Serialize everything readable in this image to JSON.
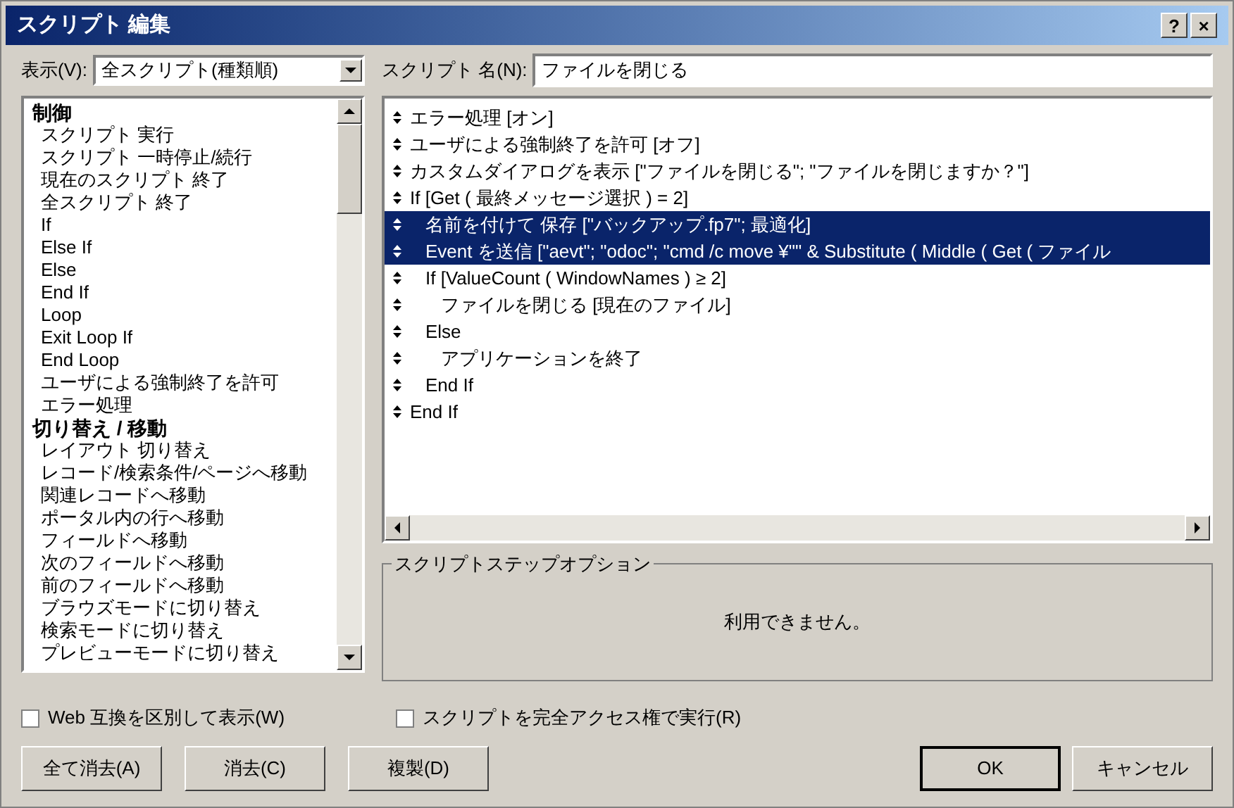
{
  "window": {
    "title": "スクリプト 編集",
    "buttons": [
      "?",
      "×"
    ]
  },
  "view": {
    "label": "表示(V):",
    "value": "全スクリプト(種類順)"
  },
  "script_name": {
    "label": "スクリプト 名(N):",
    "value": "ファイルを閉じる"
  },
  "step_groups": [
    {
      "title": "制御",
      "items": [
        "スクリプト 実行",
        "スクリプト 一時停止/続行",
        "現在のスクリプト 終了",
        "全スクリプト 終了",
        "If",
        "Else If",
        "Else",
        "End If",
        "Loop",
        "Exit Loop If",
        "End Loop",
        "ユーザによる強制終了を許可",
        "エラー処理"
      ]
    },
    {
      "title": "切り替え / 移動",
      "items": [
        "レイアウト 切り替え",
        "レコード/検索条件/ページへ移動",
        "関連レコードへ移動",
        "ポータル内の行へ移動",
        "フィールドへ移動",
        "次のフィールドへ移動",
        "前のフィールドへ移動",
        "ブラウズモードに切り替え",
        "検索モードに切り替え",
        "プレビューモードに切り替え"
      ]
    }
  ],
  "script_steps": [
    {
      "text": "エラー処理 [オン]",
      "selected": false
    },
    {
      "text": "ユーザによる強制終了を許可 [オフ]",
      "selected": false
    },
    {
      "text": "カスタムダイアログを表示 [\"ファイルを閉じる\"; \"ファイルを閉じますか？\"]",
      "selected": false
    },
    {
      "text": "If [Get ( 最終メッセージ選択 ) = 2]",
      "selected": false,
      "children": [
        {
          "text": "名前を付けて 保存 [\"バックアップ.fp7\"; 最適化]",
          "selected": true
        },
        {
          "text": "Event を送信 [\"aevt\"; \"odoc\"; \"cmd /c move ¥\"\" & Substitute ( Middle ( Get ( ファイル",
          "selected": true
        },
        {
          "text": "If [ValueCount ( WindowNames ) ≥ 2]",
          "selected": false,
          "children": [
            {
              "text": "ファイルを閉じる [現在のファイル]",
              "selected": false
            }
          ]
        },
        {
          "text": "Else",
          "selected": false,
          "children": [
            {
              "text": "アプリケーションを終了",
              "selected": false
            }
          ]
        },
        {
          "text": "End If",
          "selected": false
        }
      ]
    },
    {
      "text": "End If",
      "selected": false
    }
  ],
  "options": {
    "title": "スクリプトステップオプション",
    "message": "利用できません。"
  },
  "checkboxes": [
    {
      "label": "Web 互換を区別して表示(W)",
      "checked": false
    },
    {
      "label": "スクリプトを完全アクセス権で実行(R)",
      "checked": false
    }
  ],
  "buttons": [
    {
      "label": "全て消去(A)",
      "kind": "normal"
    },
    {
      "label": "消去(C)",
      "kind": "normal"
    },
    {
      "label": "複製(D)",
      "kind": "normal"
    },
    {
      "label": "OK",
      "kind": "default"
    },
    {
      "label": "キャンセル",
      "kind": "normal"
    }
  ]
}
